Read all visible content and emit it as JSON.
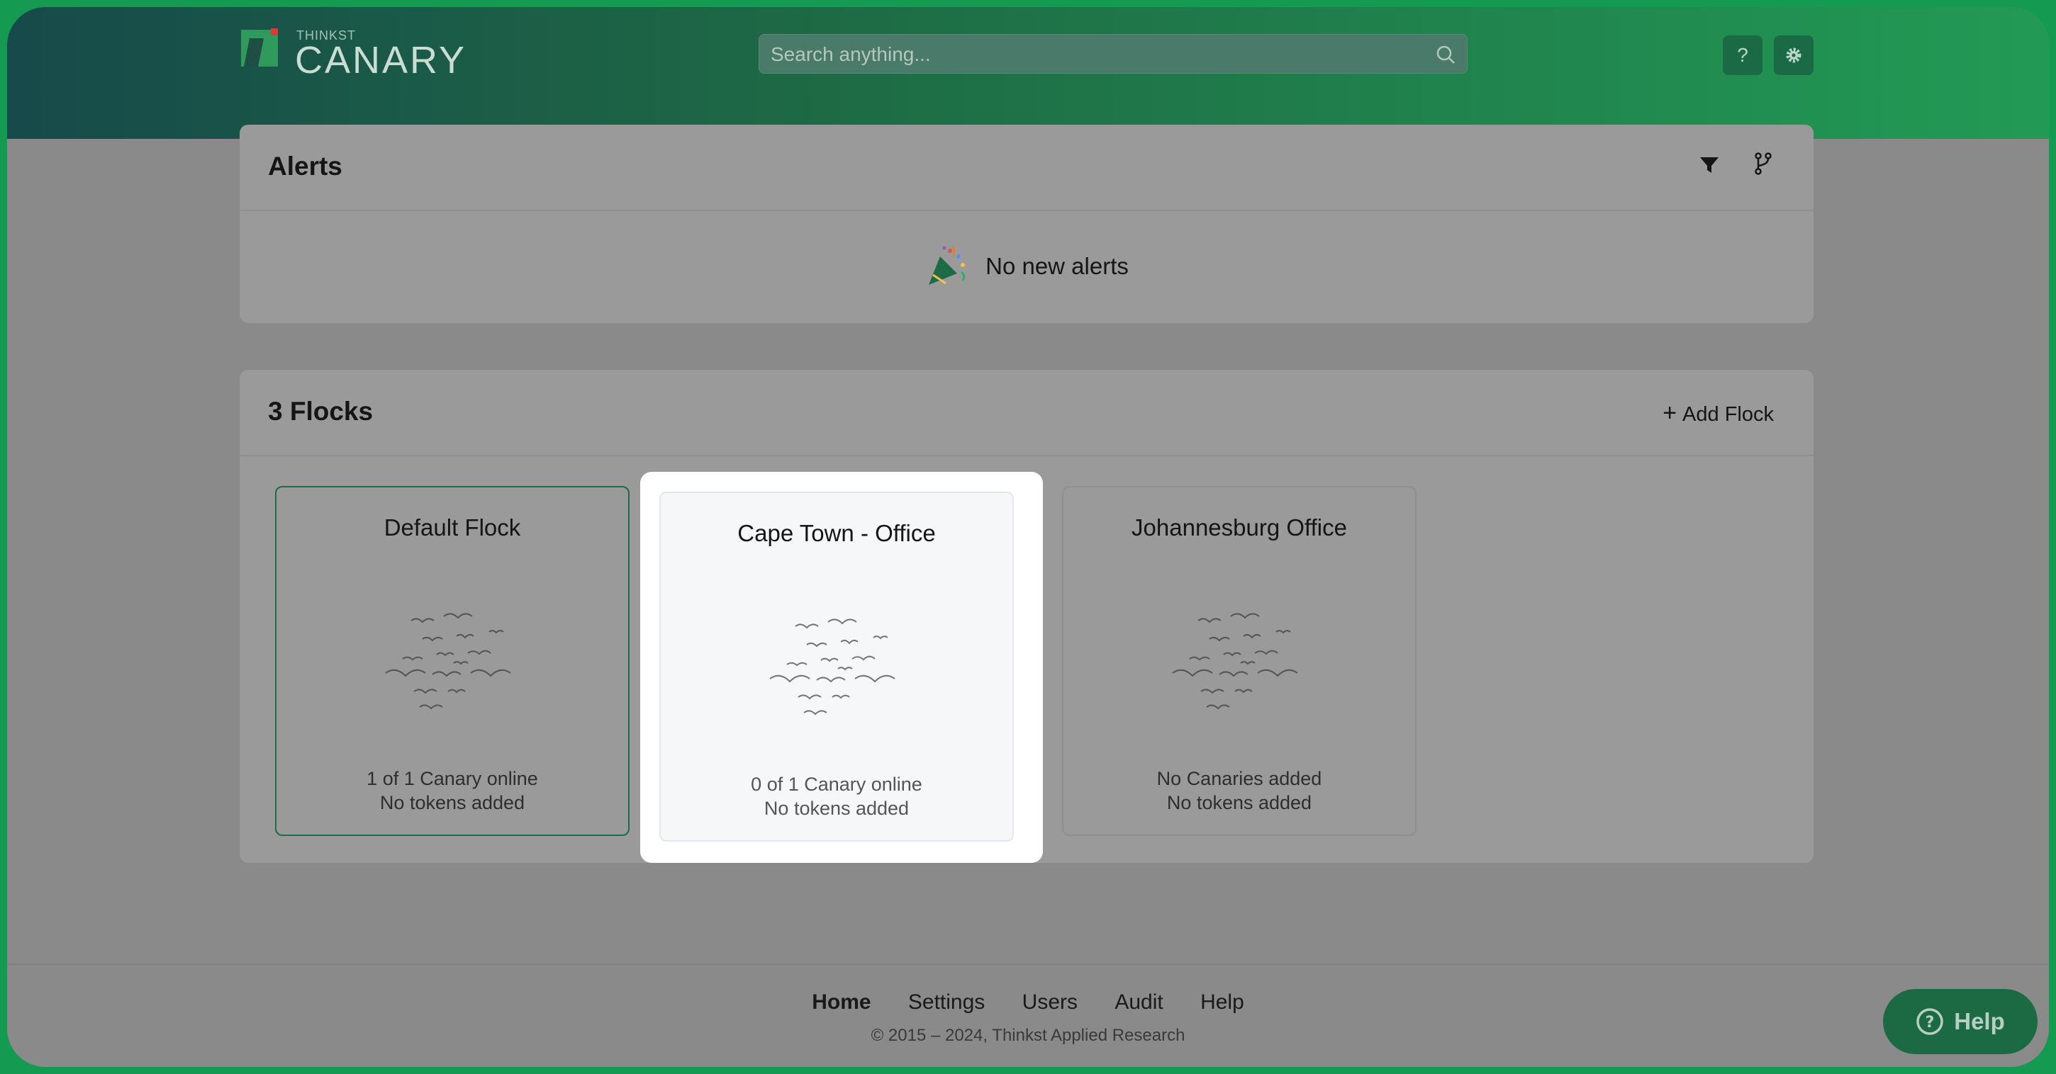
{
  "brand": {
    "small": "THINKST",
    "big": "CANARY"
  },
  "search": {
    "placeholder": "Search anything..."
  },
  "header_buttons": {
    "help": "?",
    "settings_icon": "gear-icon"
  },
  "alerts": {
    "title": "Alerts",
    "empty_text": "No new alerts",
    "icons": [
      "filter-icon",
      "branch-icon"
    ]
  },
  "flocks": {
    "title": "3 Flocks",
    "add_label": "Add Flock",
    "items": [
      {
        "name": "Default Flock",
        "status": "1 of 1 Canary online",
        "tokens": "No tokens added"
      },
      {
        "name": "Cape Town - Office",
        "status": "0 of 1 Canary online",
        "tokens": "No tokens added"
      },
      {
        "name": "Johannesburg Office",
        "status": "No Canaries added",
        "tokens": "No tokens added"
      }
    ]
  },
  "footer": {
    "nav": [
      "Home",
      "Settings",
      "Users",
      "Audit",
      "Help"
    ],
    "copyright": "© 2015 – 2024, Thinkst Applied Research"
  },
  "help_widget": {
    "label": "Help"
  },
  "colors": {
    "brand_green": "#1c6a44",
    "header_dark": "#174a4a",
    "header_bright": "#229a55"
  }
}
